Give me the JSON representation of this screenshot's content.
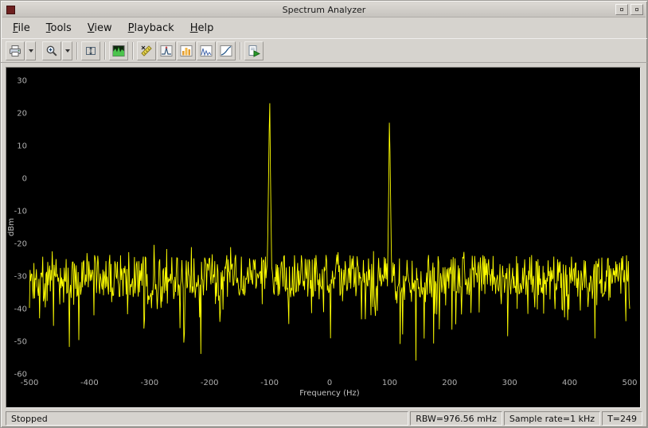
{
  "window": {
    "title": "Spectrum Analyzer"
  },
  "menu": {
    "items": [
      {
        "label": "File",
        "underline": 0
      },
      {
        "label": "Tools",
        "underline": 0
      },
      {
        "label": "View",
        "underline": 0
      },
      {
        "label": "Playback",
        "underline": 0
      },
      {
        "label": "Help",
        "underline": 0
      }
    ]
  },
  "toolbar": {
    "icons": [
      {
        "name": "print-icon"
      },
      {
        "name": "print-dropdown-icon"
      },
      {
        "name": "zoom-in-icon"
      },
      {
        "name": "zoom-dropdown-icon"
      },
      {
        "name": "autoscale-axes-icon"
      },
      {
        "name": "spectrum-settings-icon"
      },
      {
        "name": "cursor-measurements-icon"
      },
      {
        "name": "peak-finder-icon"
      },
      {
        "name": "channel-measurements-icon"
      },
      {
        "name": "distortion-measurements-icon"
      },
      {
        "name": "ccdf-measurements-icon"
      },
      {
        "name": "run-icon"
      }
    ]
  },
  "chart_data": {
    "type": "line",
    "title": "",
    "xlabel": "Frequency (Hz)",
    "ylabel": "dBm",
    "xlim": [
      -500,
      500
    ],
    "ylim": [
      -60,
      30
    ],
    "xticks": [
      -500,
      -400,
      -300,
      -200,
      -100,
      0,
      100,
      200,
      300,
      400,
      500
    ],
    "yticks": [
      30,
      20,
      10,
      0,
      -10,
      -20,
      -30,
      -40,
      -50,
      -60
    ],
    "grid": false,
    "legend": false,
    "background": "#000000",
    "trace_color": "#ffff00",
    "noise_floor_dbm": -30,
    "noise_band_dbm": [
      -40,
      -20
    ],
    "noise_dips_to_dbm": -55,
    "peaks": [
      {
        "frequency_hz": -100,
        "level_dbm": 23
      },
      {
        "frequency_hz": 100,
        "level_dbm": 17
      }
    ]
  },
  "statusbar": {
    "state": "Stopped",
    "rbw": "RBW=976.56 mHz",
    "sample_rate": "Sample rate=1 kHz",
    "time": "T=249"
  }
}
